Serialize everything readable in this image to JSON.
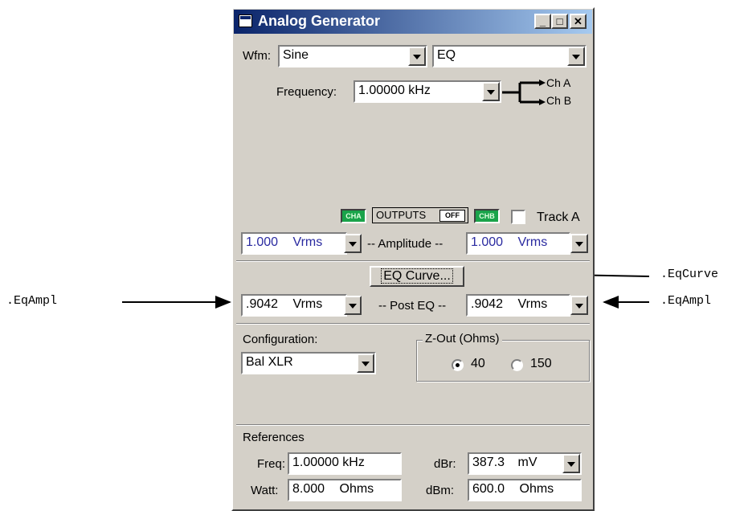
{
  "window": {
    "title": "Analog Generator"
  },
  "waveform": {
    "label": "Wfm:",
    "value": "Sine",
    "type_value": "EQ"
  },
  "frequency": {
    "label": "Frequency:",
    "value": "1.00000 kHz",
    "route_a": "Ch A",
    "route_b": "Ch B"
  },
  "outputs": {
    "cha_label": "CHA",
    "chb_label": "CHB",
    "outputs_label": "OUTPUTS",
    "off_label": "OFF",
    "track_label": "Track A"
  },
  "amplitude": {
    "label": "-- Amplitude --",
    "cha_value": "1.000",
    "cha_unit": "Vrms",
    "chb_value": "1.000",
    "chb_unit": "Vrms"
  },
  "eq_curve_button": "EQ Curve...",
  "post_eq": {
    "label": "-- Post EQ --",
    "cha_value": ".9042",
    "cha_unit": "Vrms",
    "chb_value": ".9042",
    "chb_unit": "Vrms"
  },
  "configuration": {
    "label": "Configuration:",
    "value": "Bal XLR"
  },
  "zout": {
    "label": "Z-Out (Ohms)",
    "opt1": "40",
    "opt2": "150",
    "selected": "40"
  },
  "references": {
    "label": "References",
    "freq_label": "Freq:",
    "freq_value": "1.00000 kHz",
    "dbr_label": "dBr:",
    "dbr_value": "387.3",
    "dbr_unit": "mV",
    "watt_label": "Watt:",
    "watt_value": "8.000",
    "watt_unit": "Ohms",
    "dbm_label": "dBm:",
    "dbm_value": "600.0",
    "dbm_unit": "Ohms"
  },
  "annotations": {
    "left": ".EqAmpl",
    "right_top": ".EqCurve",
    "right_bottom": ".EqAmpl"
  },
  "colors": {
    "titlebar": "#0a246a",
    "panel": "#d4d0c8",
    "led_green": "#1aa34a",
    "value_blue": "#2a2aa0"
  }
}
